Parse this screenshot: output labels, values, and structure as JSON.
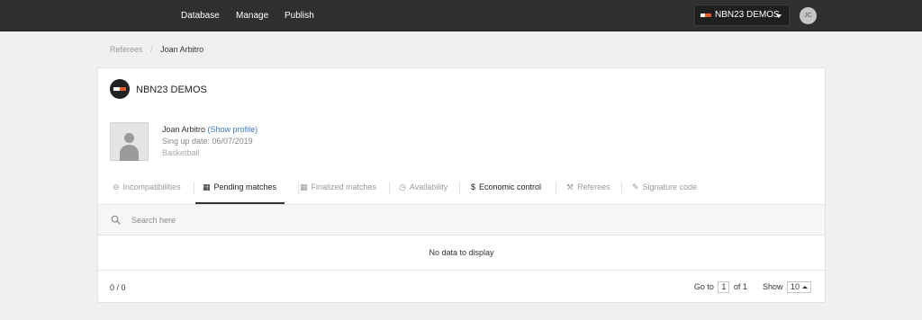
{
  "topbar": {
    "nav": [
      "Database",
      "Manage",
      "Publish"
    ],
    "org_select": "NBN23 DEMOS",
    "user_initials": "JC"
  },
  "breadcrumb": {
    "parent": "Referees",
    "current": "Joan Arbitro"
  },
  "org": {
    "name": "NBN23 DEMOS"
  },
  "profile": {
    "name": "Joan Arbitro",
    "show_profile": "(Show profile)",
    "signup": "Sing up date: 06/07/2019",
    "sport": "Basketball"
  },
  "tabs": [
    {
      "label": "Incompatibilities",
      "icon": "minus-circle-icon",
      "glyph": "⊖"
    },
    {
      "label": "Pending matches",
      "icon": "calendar-icon",
      "glyph": "▦"
    },
    {
      "label": "Finalized matches",
      "icon": "calendar-check-icon",
      "glyph": "▦"
    },
    {
      "label": "Availability",
      "icon": "clock-icon",
      "glyph": "◷"
    },
    {
      "label": "Economic control",
      "icon": "dollar-icon",
      "glyph": "$"
    },
    {
      "label": "Referees",
      "icon": "gavel-icon",
      "glyph": "⚒"
    },
    {
      "label": "Signature code",
      "icon": "pencil-icon",
      "glyph": "✎"
    }
  ],
  "search": {
    "placeholder": "Search here"
  },
  "table": {
    "empty": "No data to display"
  },
  "footer": {
    "count": "0 / 0",
    "goto_label": "Go to",
    "page": "1",
    "of_label": "of 1",
    "show_label": "Show",
    "page_size": "10"
  },
  "colors": {
    "topbar": "#2f2f2f",
    "link": "#3a78c3",
    "brand_orange": "#e85d25"
  }
}
